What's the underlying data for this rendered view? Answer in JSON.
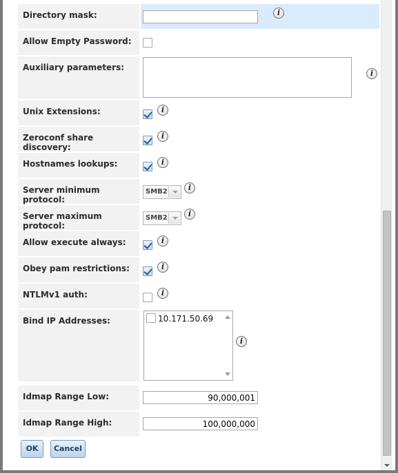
{
  "form": {
    "directory_mask": {
      "label": "Directory mask:",
      "value": ""
    },
    "allow_empty_password": {
      "label": "Allow Empty Password:",
      "checked": false
    },
    "auxiliary_parameters": {
      "label": "Auxiliary parameters:",
      "value": ""
    },
    "unix_extensions": {
      "label": "Unix Extensions:",
      "checked": true
    },
    "zeroconf": {
      "label": "Zeroconf share discovery:",
      "checked": true
    },
    "hostnames_lookups": {
      "label": "Hostnames lookups:",
      "checked": true
    },
    "server_min_protocol": {
      "label": "Server minimum protocol:",
      "value": "SMB2"
    },
    "server_max_protocol": {
      "label": "Server maximum protocol:",
      "value": "SMB2"
    },
    "allow_execute_always": {
      "label": "Allow execute always:",
      "checked": true
    },
    "obey_pam": {
      "label": "Obey pam restrictions:",
      "checked": true
    },
    "ntlmv1": {
      "label": "NTLMv1 auth:",
      "checked": false
    },
    "bind_ip": {
      "label": "Bind IP Addresses:",
      "options": [
        {
          "label": "10.171.50.69",
          "checked": false
        }
      ]
    },
    "idmap_low": {
      "label": "Idmap Range Low:",
      "value": "90,000,001"
    },
    "idmap_high": {
      "label": "Idmap Range High:",
      "value": "100,000,000"
    }
  },
  "info_icon_glyph": "i",
  "buttons": {
    "ok": "OK",
    "cancel": "Cancel"
  }
}
